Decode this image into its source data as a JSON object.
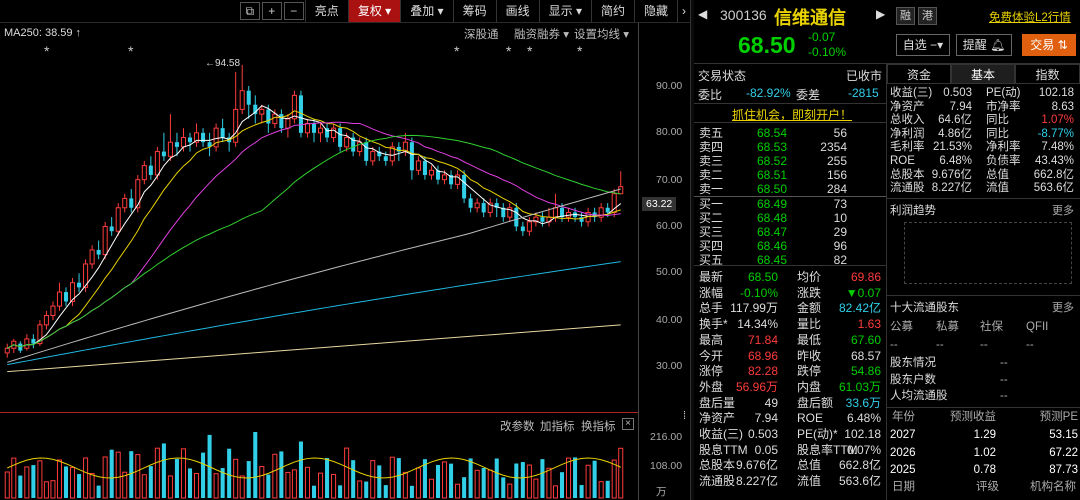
{
  "toolbar": {
    "items": [
      "亮点",
      "复权",
      "叠加",
      "筹码",
      "画线",
      "显示",
      "简约",
      "隐藏"
    ],
    "selected": "复权",
    "icons": [
      "copy-icon",
      "plus-icon",
      "minus-icon"
    ]
  },
  "ma_label": "MA250: 38.59 ↑",
  "subtabs": [
    "深股通",
    "融资融券",
    "设置均线"
  ],
  "peak_label": "94.58",
  "price_ticks": [
    "90.00",
    "80.00",
    "70.00",
    "60.00",
    "50.00",
    "40.00",
    "30.00"
  ],
  "current_price_tag": "63.22",
  "bottom_tools": [
    "改参数",
    "加指标",
    "换指标"
  ],
  "volume_ticks": [
    "216.00",
    "108.00",
    "万"
  ],
  "stock": {
    "code": "300136",
    "name": "信维通信",
    "price": "68.50",
    "change": "-0.07",
    "change_pct": "-0.10%",
    "tags": [
      "融",
      "港"
    ],
    "trial_link": "免费体验L2行情",
    "buttons": {
      "watchlist": "自选",
      "alert": "提醒",
      "trade": "交易"
    }
  },
  "trade_status": {
    "label": "交易状态",
    "value": "已收市"
  },
  "ratio": {
    "wb_label": "委比",
    "wb": "-82.92%",
    "wc_label": "委差",
    "wc": "-2815"
  },
  "promo": "抓住机会，即刻开户！",
  "sells": [
    {
      "label": "卖五",
      "price": "68.54",
      "vol": "56"
    },
    {
      "label": "卖四",
      "price": "68.53",
      "vol": "2354"
    },
    {
      "label": "卖三",
      "price": "68.52",
      "vol": "255"
    },
    {
      "label": "卖二",
      "price": "68.51",
      "vol": "156"
    },
    {
      "label": "卖一",
      "price": "68.50",
      "vol": "284"
    }
  ],
  "buys": [
    {
      "label": "买一",
      "price": "68.49",
      "vol": "73"
    },
    {
      "label": "买二",
      "price": "68.48",
      "vol": "10"
    },
    {
      "label": "买三",
      "price": "68.47",
      "vol": "29"
    },
    {
      "label": "买四",
      "price": "68.46",
      "vol": "96"
    },
    {
      "label": "买五",
      "price": "68.45",
      "vol": "82"
    }
  ],
  "quote": [
    [
      "最新",
      "68.50",
      "均价",
      "69.86"
    ],
    [
      "涨幅",
      "-0.10%",
      "涨跌",
      "▼0.07"
    ],
    [
      "总手",
      "117.99万",
      "金额",
      "82.42亿"
    ],
    [
      "换手*",
      "14.34%",
      "量比",
      "1.63"
    ],
    [
      "最高",
      "71.84",
      "最低",
      "67.60"
    ],
    [
      "今开",
      "68.96",
      "昨收",
      "68.57"
    ],
    [
      "涨停",
      "82.28",
      "跌停",
      "54.86"
    ],
    [
      "外盘",
      "56.96万",
      "内盘",
      "61.03万"
    ],
    [
      "盘后量",
      "49",
      "盘后额",
      "33.6万"
    ],
    [
      "净资产",
      "7.94",
      "ROE",
      "6.48%"
    ],
    [
      "收益(三)",
      "0.503",
      "PE(动)*",
      "102.18"
    ],
    [
      "股息TTM",
      "0.05",
      "股息率TTM",
      "0.07%"
    ],
    [
      "总股本",
      "9.676亿",
      "总值",
      "662.8亿"
    ],
    [
      "流通股",
      "8.227亿",
      "流值",
      "563.6亿"
    ]
  ],
  "right_tabs": [
    "资金",
    "基本",
    "指数"
  ],
  "fundamentals": [
    [
      "收益(三)",
      "0.503",
      "PE(动)",
      "102.18"
    ],
    [
      "净资产",
      "7.94",
      "市净率",
      "8.63"
    ],
    [
      "总收入",
      "64.6亿",
      "同比",
      "1.07%"
    ],
    [
      "净利润",
      "4.86亿",
      "同比",
      "-8.77%"
    ],
    [
      "毛利率",
      "21.53%",
      "净利率",
      "7.48%"
    ],
    [
      "ROE",
      "6.48%",
      "负债率",
      "43.43%"
    ],
    [
      "总股本",
      "9.676亿",
      "总值",
      "662.8亿"
    ],
    [
      "流通股",
      "8.227亿",
      "流值",
      "563.6亿"
    ]
  ],
  "profit_trend": {
    "title": "利润趋势",
    "more": "更多"
  },
  "holders": {
    "title": "十大流通股东",
    "more": "更多",
    "cols": [
      "公募",
      "私募",
      "社保",
      "QFII"
    ],
    "vals": [
      "--",
      "--",
      "--",
      "--"
    ],
    "rows": [
      [
        "股东情况",
        "--"
      ],
      [
        "股东户数",
        "--"
      ],
      [
        "人均流通股",
        "--"
      ]
    ]
  },
  "forecast": {
    "headers": [
      "年份",
      "预测收益",
      "预测PE"
    ],
    "rows": [
      [
        "2027",
        "1.29",
        "53.15"
      ],
      [
        "2026",
        "1.02",
        "67.22"
      ],
      [
        "2025",
        "0.78",
        "87.73"
      ]
    ],
    "footer": [
      "日期",
      "评级",
      "机构名称"
    ]
  },
  "colors": {
    "up": "#ff3b3b",
    "down": "#31d0e8",
    "ma5": "#ffffff",
    "ma10": "#e8d200",
    "ma20": "#e040e0",
    "ma60": "#30d030",
    "ma120": "#bbbbbb",
    "ma250a": "#20b8e0",
    "ma250b": "#e8d8a0"
  }
}
